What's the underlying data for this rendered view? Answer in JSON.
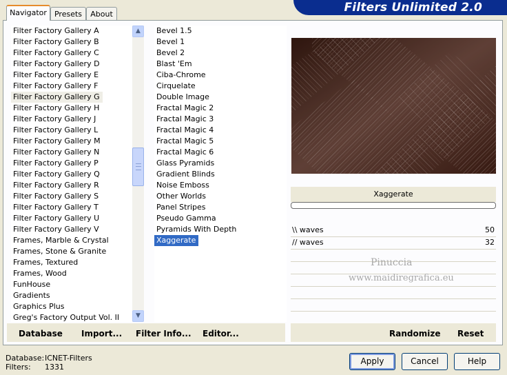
{
  "tabs": [
    {
      "label": "Navigator",
      "active": true
    },
    {
      "label": "Presets",
      "active": false
    },
    {
      "label": "About",
      "active": false
    }
  ],
  "banner": {
    "title": "Filters Unlimited 2.0"
  },
  "categories": {
    "items": [
      "Filter Factory Gallery A",
      "Filter Factory Gallery B",
      "Filter Factory Gallery C",
      "Filter Factory Gallery D",
      "Filter Factory Gallery E",
      "Filter Factory Gallery F",
      "Filter Factory Gallery G",
      "Filter Factory Gallery H",
      "Filter Factory Gallery J",
      "Filter Factory Gallery L",
      "Filter Factory Gallery M",
      "Filter Factory Gallery N",
      "Filter Factory Gallery P",
      "Filter Factory Gallery Q",
      "Filter Factory Gallery R",
      "Filter Factory Gallery S",
      "Filter Factory Gallery T",
      "Filter Factory Gallery U",
      "Filter Factory Gallery V",
      "Frames, Marble & Crystal",
      "Frames, Stone & Granite",
      "Frames, Textured",
      "Frames, Wood",
      "FunHouse",
      "Gradients",
      "Graphics Plus",
      "Greg's Factory Output Vol. II"
    ],
    "selected": "Filter Factory Gallery G"
  },
  "filters": {
    "items": [
      "Bevel 1.5",
      "Bevel 1",
      "Bevel 2",
      "Blast 'Em",
      "Ciba-Chrome",
      "Cirquelate",
      "Double Image",
      "Fractal Magic 2",
      "Fractal Magic 3",
      "Fractal Magic 4",
      "Fractal Magic 5",
      "Fractal Magic 6",
      "Glass Pyramids",
      "Gradient Blinds",
      "Noise Emboss",
      "Other Worlds",
      "Panel Stripes",
      "Pseudo Gamma",
      "Pyramids With Depth",
      "Xaggerate"
    ],
    "selected": "Xaggerate"
  },
  "preview": {
    "filter_name": "Xaggerate",
    "colors": {
      "dark": "#3f2218",
      "light": "#b8aaa4"
    }
  },
  "params": [
    {
      "name": "\\\\ waves",
      "value": "50"
    },
    {
      "name": "// waves",
      "value": "32"
    }
  ],
  "watermark": {
    "line1": "Pinuccia",
    "line2": "www.maidiregrafica.eu"
  },
  "bottom_bar": {
    "database": "Database",
    "import": "Import...",
    "filter_info": "Filter Info...",
    "editor": "Editor...",
    "randomize": "Randomize",
    "reset": "Reset"
  },
  "status": {
    "database_label": "Database:",
    "database_value": "ICNET-Filters",
    "filters_label": "Filters:",
    "filters_value": "1331"
  },
  "buttons": {
    "apply": "Apply",
    "cancel": "Cancel",
    "help": "Help"
  },
  "colors": {
    "accent": "#0a2d8f",
    "selection": "#316ac5",
    "tab_highlight": "#e68b2c"
  }
}
